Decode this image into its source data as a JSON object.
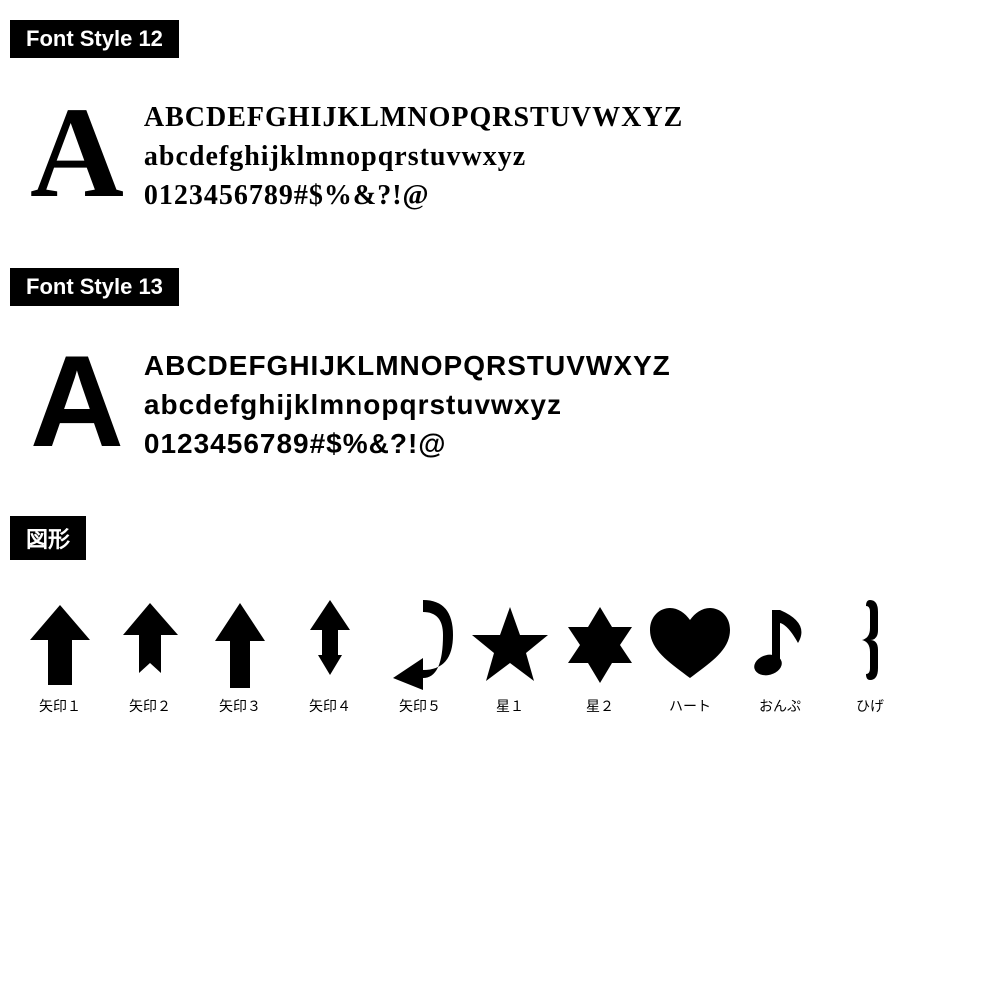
{
  "sections": [
    {
      "id": "font-style-12",
      "label": "Font Style 12",
      "bigLetter": "A",
      "rows": [
        "ABCDEFGHIJKLMNOPQRSTUVWXYZ",
        "abcdefghijklmnopqrstuvwxyz",
        "0123456789#$%&?!@"
      ],
      "fontClass": "font-style-12"
    },
    {
      "id": "font-style-13",
      "label": "Font Style 13",
      "bigLetter": "A",
      "rows": [
        "ABCDEFGHIJKLMNOPQRSTUVWXYZ",
        "abcdefghijklmnopqrstuvwxyz",
        "0123456789#$%&?!@"
      ],
      "fontClass": "font-style-13"
    }
  ],
  "shapes": {
    "label": "図形",
    "items": [
      {
        "id": "arrow1",
        "label": "矢印１"
      },
      {
        "id": "arrow2",
        "label": "矢印２"
      },
      {
        "id": "arrow3",
        "label": "矢印３"
      },
      {
        "id": "arrow4",
        "label": "矢印４"
      },
      {
        "id": "arrow5",
        "label": "矢印５"
      },
      {
        "id": "star1",
        "label": "星１"
      },
      {
        "id": "star2",
        "label": "星２"
      },
      {
        "id": "heart",
        "label": "ハート"
      },
      {
        "id": "music",
        "label": "おんぷ"
      },
      {
        "id": "mustache",
        "label": "ひげ"
      }
    ]
  }
}
